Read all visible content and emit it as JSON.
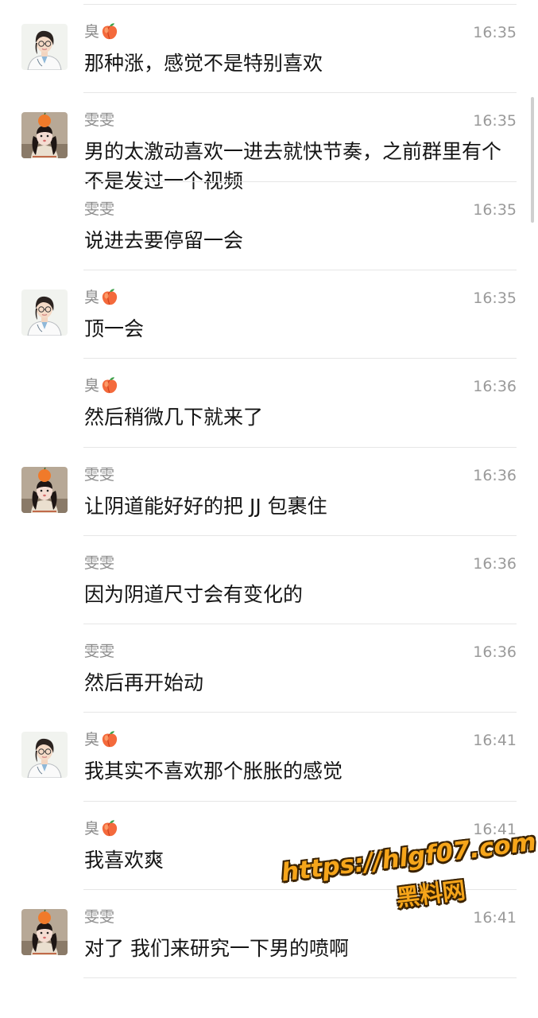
{
  "contacts": {
    "chou": {
      "name": "臭",
      "avatar_icon": "avatar-doctor-glasses"
    },
    "wenwen": {
      "name": "雯雯",
      "avatar_icon": "avatar-girl-orange-hat"
    }
  },
  "messages": [
    {
      "sender": "臭",
      "time": "16:35",
      "text": "那种涨，感觉不是特别喜欢",
      "has_peach": true,
      "show_avatar": true
    },
    {
      "sender": "雯雯",
      "time": "16:35",
      "text": "男的太激动喜欢一进去就快节奏，之前群里有个不是发过一个视频",
      "has_peach": false,
      "show_avatar": true
    },
    {
      "sender": "雯雯",
      "time": "16:35",
      "text": "说进去要停留一会",
      "has_peach": false,
      "show_avatar": false
    },
    {
      "sender": "臭",
      "time": "16:35",
      "text": "顶一会",
      "has_peach": true,
      "show_avatar": true
    },
    {
      "sender": "臭",
      "time": "16:36",
      "text": "然后稍微几下就来了",
      "has_peach": true,
      "show_avatar": false
    },
    {
      "sender": "雯雯",
      "time": "16:36",
      "text": "让阴道能好好的把 JJ 包裹住",
      "has_peach": false,
      "show_avatar": true
    },
    {
      "sender": "雯雯",
      "time": "16:36",
      "text": "因为阴道尺寸会有变化的",
      "has_peach": false,
      "show_avatar": false
    },
    {
      "sender": "雯雯",
      "time": "16:36",
      "text": "然后再开始动",
      "has_peach": false,
      "show_avatar": false
    },
    {
      "sender": "臭",
      "time": "16:41",
      "text": "我其实不喜欢那个胀胀的感觉",
      "has_peach": true,
      "show_avatar": true
    },
    {
      "sender": "臭",
      "time": "16:41",
      "text": "我喜欢爽",
      "has_peach": true,
      "show_avatar": false
    },
    {
      "sender": "雯雯",
      "time": "16:41",
      "text": "对了 我们来研究一下男的喷啊",
      "has_peach": false,
      "show_avatar": true
    }
  ],
  "watermark": {
    "url": "https://hlgf07.com",
    "label": "黑料网"
  },
  "colors": {
    "divider": "#e6e6e6",
    "name": "#8c8c8c",
    "time": "#9a9a9a",
    "text": "#151515",
    "watermark": "#f6a51a"
  }
}
